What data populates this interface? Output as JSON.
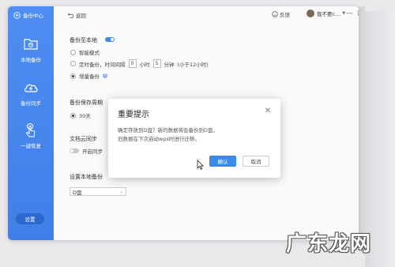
{
  "app": {
    "title": "备份中心",
    "back_label": "返回",
    "feedback_label": "反馈",
    "user_name": "我不要c...",
    "window_controls": [
      "—",
      "□"
    ]
  },
  "sidebar": {
    "items": [
      {
        "label": "本地备份",
        "icon": "folder-icon"
      },
      {
        "label": "备份同步",
        "icon": "cloud-upload-icon"
      },
      {
        "label": "一键恢复",
        "icon": "hand-tap-icon"
      }
    ],
    "settings_label": "设置"
  },
  "main": {
    "backup_local": {
      "title": "备份至本地",
      "toggle_on": true,
      "options": {
        "smart": "智能模式",
        "timed_prefix": "定时备份，时间间隔",
        "hours_value": "0",
        "hours_unit": "小时",
        "minutes_value": "5",
        "minutes_unit": "分钟",
        "limit_note": "(小于12小时)",
        "incremental": "增量备份"
      },
      "selected": "incremental"
    },
    "retention": {
      "title": "备份保存周期",
      "option_30": "30天"
    },
    "cloud_sync": {
      "title": "文档云同步",
      "toggle_label": "开启同步",
      "toggle_on": false
    },
    "local_path": {
      "title": "设置本地备份",
      "selected_drive": "D盘"
    }
  },
  "dialog": {
    "title": "重要提示",
    "close_symbol": "✕",
    "line1": "确定存放到D盘？新的数据将会备份到D盘，",
    "line2": "旧数据在下次启动wps时进行迁移。",
    "ok_label": "确认",
    "cancel_label": "取消"
  },
  "watermark": "广东龙网",
  "colors": {
    "sidebar": "#4f8df2",
    "accent": "#3c8ae8",
    "toggle_on": "#3c8ae8",
    "toggle_off": "#c8c8c8"
  }
}
